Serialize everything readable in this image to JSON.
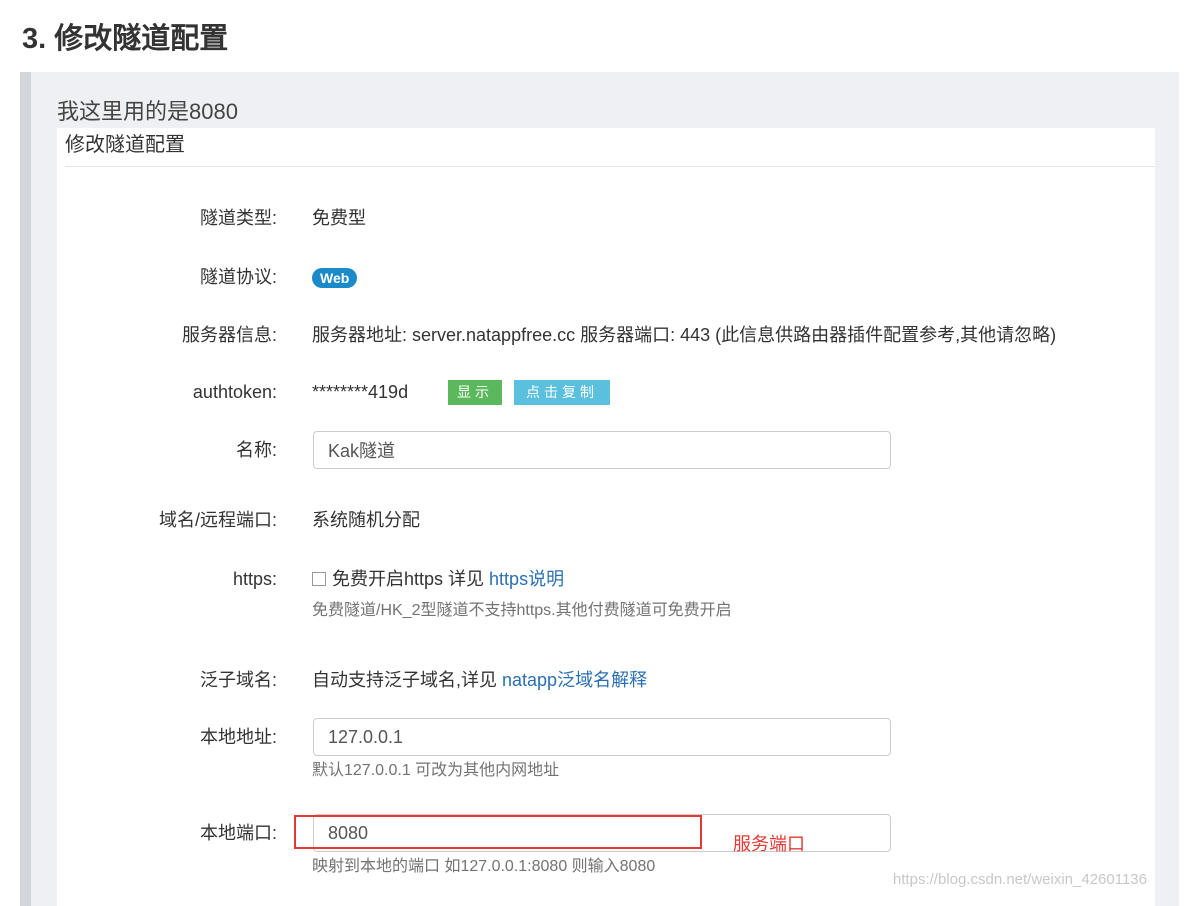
{
  "heading": "3. 修改隧道配置",
  "quote_text": "我这里用的是8080",
  "panel_title": "修改隧道配置",
  "form": {
    "tunnel_type": {
      "label": "隧道类型:",
      "value": "免费型"
    },
    "protocol": {
      "label": "隧道协议:",
      "badge": "Web"
    },
    "server_info": {
      "label": "服务器信息:",
      "value": "服务器地址: server.natappfree.cc 服务器端口: 443 (此信息供路由器插件配置参考,其他请忽略)"
    },
    "authtoken": {
      "label": "authtoken:",
      "value": "********419d",
      "show_button": "显示",
      "copy_button": "点击复制"
    },
    "name": {
      "label": "名称:",
      "value": "Kak隧道"
    },
    "domain": {
      "label": "域名/远程端口:",
      "value": "系统随机分配"
    },
    "https": {
      "label": "https:",
      "checkbox_text": "免费开启https 详见",
      "link": "https说明",
      "help": "免费隧道/HK_2型隧道不支持https.其他付费隧道可免费开启"
    },
    "wildcard": {
      "label": "泛子域名:",
      "text": "自动支持泛子域名,详见",
      "link": "natapp泛域名解释"
    },
    "local_address": {
      "label": "本地地址:",
      "value": "127.0.0.1",
      "help": "默认127.0.0.1 可改为其他内网地址"
    },
    "local_port": {
      "label": "本地端口:",
      "value": "8080",
      "help": "映射到本地的端口 如127.0.0.1:8080 则输入8080"
    }
  },
  "annotation": "服务端口",
  "watermark": "https://blog.csdn.net/weixin_42601136",
  "colors": {
    "annotation_red": "#e53935",
    "link_blue": "#2a6fb5",
    "badge_blue": "#1b8ac9",
    "show_green": "#5cb85c",
    "copy_cyan": "#5bc0de"
  }
}
